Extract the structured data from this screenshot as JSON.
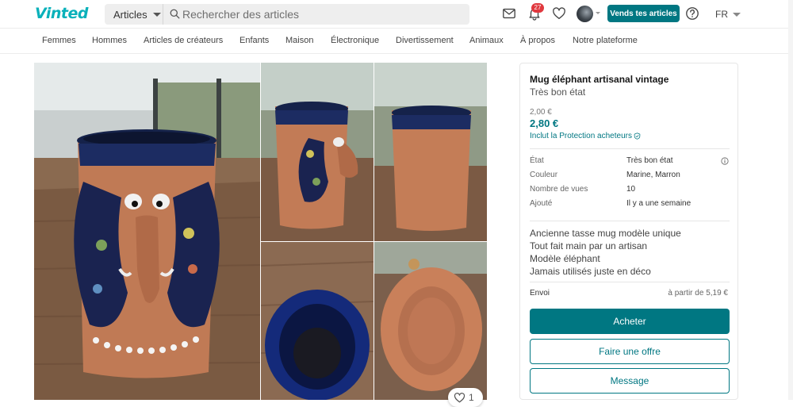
{
  "header": {
    "logo": "Vinted",
    "category_select": "Articles",
    "search_placeholder": "Rechercher des articles",
    "notifications_count": "27",
    "sell_button": "Vends tes articles",
    "language": "FR"
  },
  "nav": {
    "categories": [
      "Femmes",
      "Hommes",
      "Articles de créateurs",
      "Enfants",
      "Maison",
      "Électronique",
      "Divertissement",
      "Animaux",
      "À propos",
      "Notre plateforme"
    ]
  },
  "gallery": {
    "favorites_count": "1"
  },
  "item": {
    "title": "Mug éléphant artisanal vintage",
    "condition": "Très bon état",
    "price": "2,00 €",
    "price_total": "2,80 €",
    "protection": "Inclut la Protection acheteurs",
    "attributes": [
      {
        "label": "État",
        "value": "Très bon état"
      },
      {
        "label": "Couleur",
        "value": "Marine, Marron"
      },
      {
        "label": "Nombre de vues",
        "value": "10"
      },
      {
        "label": "Ajouté",
        "value": "Il y a une semaine"
      }
    ],
    "description": [
      "Ancienne tasse mug modèle unique",
      "Tout fait main par un artisan",
      "Modèle éléphant",
      "Jamais utilisés juste en déco"
    ],
    "shipping_label": "Envoi",
    "shipping_value": "à partir de 5,19 €",
    "buy_button": "Acheter",
    "offer_button": "Faire une offre",
    "message_button": "Message"
  },
  "colors": {
    "brand": "#09b1ba",
    "primary": "#007782",
    "badge": "#e0383e"
  },
  "icons": [
    "search-icon",
    "mail-icon",
    "bell-icon",
    "heart-icon",
    "help-icon",
    "info-icon",
    "shield-check-icon"
  ]
}
